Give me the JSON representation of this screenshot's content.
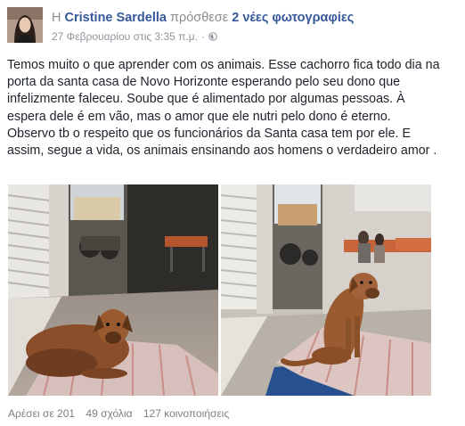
{
  "header": {
    "prefix": "Η",
    "author": "Cristine Sardella",
    "verb": "πρόσθεσε",
    "photos_link": "2 νέες φωτογραφίες",
    "timestamp": "27 Φεβρουαρίου στις 3:35 π.μ.",
    "separator": "·",
    "privacy_icon": "globe-icon"
  },
  "post": {
    "text": "Temos muito o que aprender com os animais. Esse cachorro fica todo dia na porta da santa casa de Novo Horizonte esperando pelo seu dono que infelizmente faleceu. Soube que é alimentado por algumas pessoas. À espera dele é em vão, mas o amor que ele nutri pelo dono é eterno. Observo tb o respeito que os funcionários da Santa casa tem por ele. E assim, segue a vida, os animais ensinando aos homens o verdadeiro amor ."
  },
  "footer": {
    "likes": "Αρέσει σε 201",
    "comments": "49 σχόλια",
    "shares": "127 κοινοποιήσεις"
  },
  "colors": {
    "link": "#365899",
    "muted": "#90949c",
    "text": "#1d2129"
  }
}
